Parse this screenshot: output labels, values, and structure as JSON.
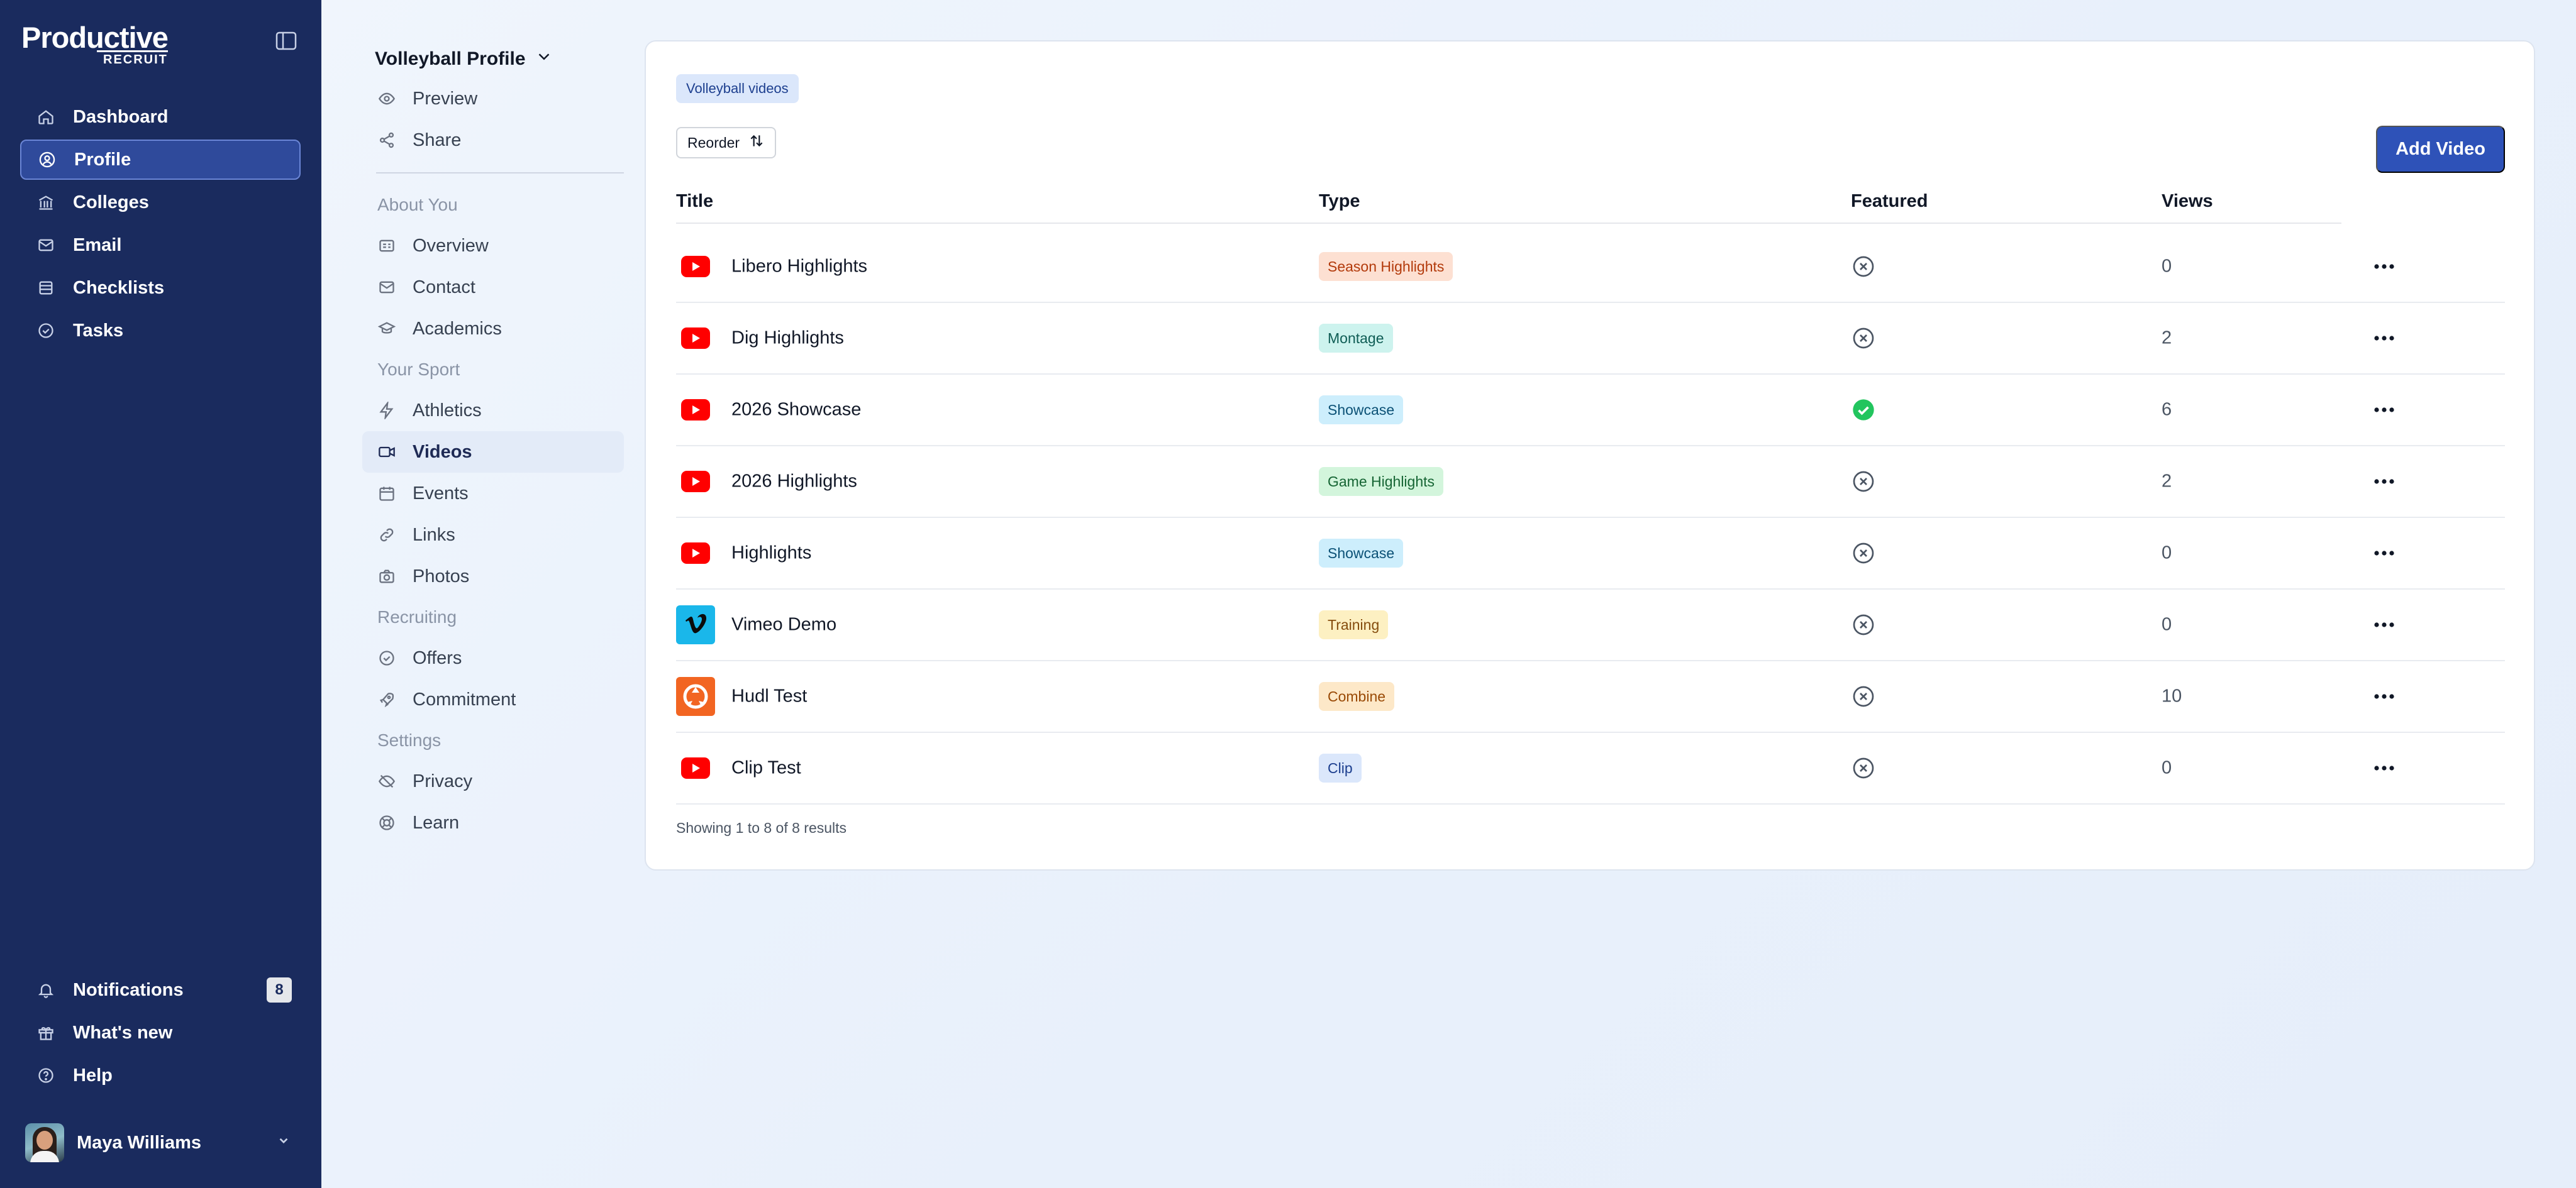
{
  "app": {
    "logo_main": "Productive",
    "logo_sub": "RECRUIT"
  },
  "sidebar": {
    "items": [
      {
        "label": "Dashboard",
        "icon": "home-icon"
      },
      {
        "label": "Profile",
        "icon": "user-circle-icon",
        "active": true
      },
      {
        "label": "Colleges",
        "icon": "building-icon"
      },
      {
        "label": "Email",
        "icon": "mail-icon"
      },
      {
        "label": "Checklists",
        "icon": "list-icon"
      },
      {
        "label": "Tasks",
        "icon": "check-circle-icon"
      }
    ],
    "bottom": {
      "notifications": {
        "label": "Notifications",
        "count": "8"
      },
      "whats_new": {
        "label": "What's new"
      },
      "help": {
        "label": "Help"
      }
    },
    "user": {
      "name": "Maya Williams"
    }
  },
  "subnav": {
    "profile_select": "Volleyball Profile",
    "preview": "Preview",
    "share": "Share",
    "sections": {
      "about": "About You",
      "sport": "Your Sport",
      "recruiting": "Recruiting",
      "settings": "Settings"
    },
    "items": {
      "overview": "Overview",
      "contact": "Contact",
      "academics": "Academics",
      "athletics": "Athletics",
      "videos": "Videos",
      "events": "Events",
      "links": "Links",
      "photos": "Photos",
      "offers": "Offers",
      "commitment": "Commitment",
      "privacy": "Privacy",
      "learn": "Learn"
    }
  },
  "main": {
    "chip": "Volleyball videos",
    "reorder_label": "Reorder",
    "add_button": "Add Video",
    "columns": {
      "title": "Title",
      "type": "Type",
      "featured": "Featured",
      "views": "Views"
    },
    "rows": [
      {
        "source": "youtube",
        "title": "Libero Highlights",
        "type": "Season Highlights",
        "featured": false,
        "views": "0"
      },
      {
        "source": "youtube",
        "title": "Dig Highlights",
        "type": "Montage",
        "featured": false,
        "views": "2"
      },
      {
        "source": "youtube",
        "title": "2026 Showcase",
        "type": "Showcase",
        "featured": true,
        "views": "6"
      },
      {
        "source": "youtube",
        "title": "2026 Highlights",
        "type": "Game Highlights",
        "featured": false,
        "views": "2"
      },
      {
        "source": "youtube",
        "title": "Highlights",
        "type": "Showcase",
        "featured": false,
        "views": "0"
      },
      {
        "source": "vimeo",
        "title": "Vimeo Demo",
        "type": "Training",
        "featured": false,
        "views": "0"
      },
      {
        "source": "hudl",
        "title": "Hudl Test",
        "type": "Combine",
        "featured": false,
        "views": "10"
      },
      {
        "source": "youtube",
        "title": "Clip Test",
        "type": "Clip",
        "featured": false,
        "views": "0"
      }
    ],
    "results_text": "Showing 1 to 8 of 8 results"
  },
  "colors": {
    "sidebar_bg": "#1a2b5e",
    "accent": "#2e52b8",
    "featured_on": "#22c55e",
    "youtube": "#ff0000",
    "vimeo": "#1ab7ea",
    "hudl": "#f26522",
    "badges": {
      "Season Highlights": {
        "bg": "#fde0d2",
        "fg": "#b33a0b"
      },
      "Montage": {
        "bg": "#cdf3ee",
        "fg": "#0f5d55"
      },
      "Showcase": {
        "bg": "#cdeefc",
        "fg": "#0b5176"
      },
      "Game Highlights": {
        "bg": "#d3f5dc",
        "fg": "#166534"
      },
      "Training": {
        "bg": "#fdf0c2",
        "fg": "#854d0e"
      },
      "Combine": {
        "bg": "#fde8c8",
        "fg": "#9a4a06"
      },
      "Clip": {
        "bg": "#dbe7fb",
        "fg": "#1d3f8f"
      }
    }
  }
}
